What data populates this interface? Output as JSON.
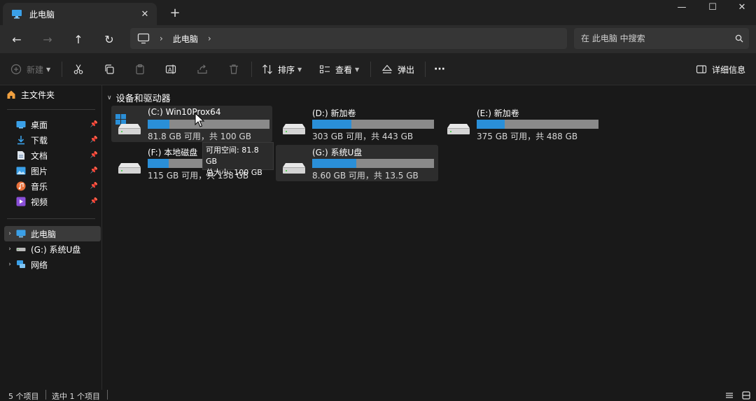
{
  "window": {
    "tab_title": "此电脑",
    "tab_close": "✕",
    "new_tab": "+",
    "minimize": "—",
    "maximize": "☐",
    "close": "✕"
  },
  "nav": {
    "back": "←",
    "forward": "→",
    "up": "↑",
    "refresh": "↻",
    "breadcrumb_sep": "›",
    "breadcrumb": [
      "此电脑"
    ],
    "search_placeholder": "在 此电脑 中搜索"
  },
  "toolbar": {
    "new_label": "新建",
    "sort_label": "排序",
    "view_label": "查看",
    "eject_label": "弹出",
    "more_label": "···",
    "details_label": "详细信息"
  },
  "sidebar": {
    "home": "主文件夹",
    "quick": [
      {
        "label": "桌面",
        "icon": "desktop-icon"
      },
      {
        "label": "下载",
        "icon": "download-icon"
      },
      {
        "label": "文档",
        "icon": "document-icon"
      },
      {
        "label": "图片",
        "icon": "pictures-icon"
      },
      {
        "label": "音乐",
        "icon": "music-icon"
      },
      {
        "label": "视频",
        "icon": "videos-icon"
      }
    ],
    "tree": [
      {
        "label": "此电脑",
        "icon": "pc-icon",
        "selected": true
      },
      {
        "label": "(G:) 系统U盘",
        "icon": "usb-drive-icon",
        "selected": false
      },
      {
        "label": "网络",
        "icon": "network-icon",
        "selected": false
      }
    ]
  },
  "content": {
    "group_title": "设备和驱动器",
    "drives": [
      {
        "name": "(C:) Win10Prox64",
        "info": "81.8 GB 可用，共 100 GB",
        "used_fraction": 0.18
      },
      {
        "name": "(D:) 新加卷",
        "info": "303 GB 可用，共 443 GB",
        "used_fraction": 0.32
      },
      {
        "name": "(E:) 新加卷",
        "info": "375 GB 可用，共 488 GB",
        "used_fraction": 0.23
      },
      {
        "name": "(F:) 本地磁盘",
        "info": "115 GB 可用，共 138 GB",
        "used_fraction": 0.17
      },
      {
        "name": "(G:) 系统U盘",
        "info": "8.60 GB 可用，共 13.5 GB",
        "used_fraction": 0.36
      }
    ],
    "tooltip": {
      "free": "可用空间: 81.8 GB",
      "total": "总大小: 100 GB"
    }
  },
  "status": {
    "count": "5 个项目",
    "selected": "选中 1 个项目"
  },
  "colors": {
    "accent": "#2a8fd8",
    "bar_track": "#8a8a8a"
  }
}
